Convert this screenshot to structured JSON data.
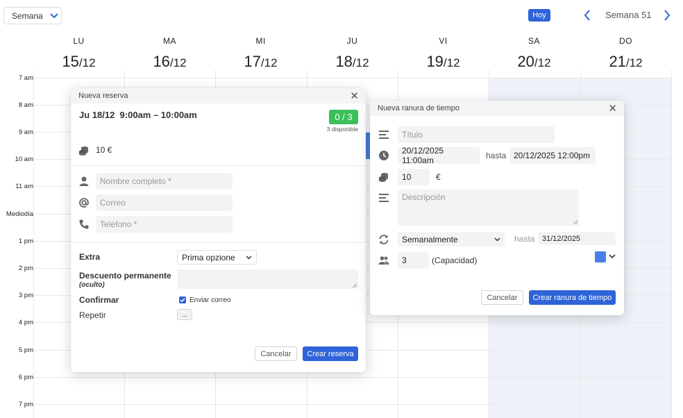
{
  "toolbar": {
    "view_select": "Semana",
    "today_button": "Hoy",
    "week_label": "Semana 51"
  },
  "days": [
    {
      "abbr": "LU",
      "day": "15",
      "month": "/12"
    },
    {
      "abbr": "MA",
      "day": "16",
      "month": "/12"
    },
    {
      "abbr": "MI",
      "day": "17",
      "month": "/12"
    },
    {
      "abbr": "JU",
      "day": "18",
      "month": "/12"
    },
    {
      "abbr": "VI",
      "day": "19",
      "month": "/12"
    },
    {
      "abbr": "SA",
      "day": "20",
      "month": "/12"
    },
    {
      "abbr": "DO",
      "day": "21",
      "month": "/12"
    }
  ],
  "hours": [
    "7 am",
    "8 am",
    "9 am",
    "10 am",
    "11 am",
    "Mediodía",
    "1 pm",
    "2 pm",
    "3 pm",
    "4 pm",
    "5 pm",
    "6 pm",
    "7 pm"
  ],
  "booking": {
    "title": "Nueva reserva",
    "slot": "Ju 18/12  9:00am – 10:00am",
    "capacity_badge": "0 / 3",
    "available": "3 disponible",
    "price": "10 €",
    "name_placeholder": "Nombre completo *",
    "email_placeholder": "Correo",
    "phone_placeholder": "Teléfono *",
    "extra_label": "Extra",
    "extra_value": "Prima opzione",
    "discount_label": "Descuento permanente",
    "discount_sub": "(oculto)",
    "confirm_label": "Confirmar",
    "send_email_label": "Enviar correo",
    "repeat_label": "Repetir",
    "repeat_button": "...",
    "cancel": "Cancelar",
    "submit": "Crear reserva"
  },
  "slot_dialog": {
    "title": "Nueva ranura de tiempo",
    "title_placeholder": "Título",
    "start": "20/12/2025 11:00am",
    "until_label": "hasta",
    "end": "20/12/2025 12:00pm",
    "price": "10",
    "currency": "€",
    "description_placeholder": "Descripción",
    "repeat_value": "Semanalmente",
    "repeat_until_label": "hasta",
    "repeat_until": "31/12/2025",
    "capacity": "3",
    "capacity_label": "(Capacidad)",
    "color": "#4a80e6",
    "cancel": "Cancelar",
    "submit": "Crear ranura de tiempo"
  },
  "colors": {
    "accent": "#2f64d8",
    "success": "#3cbf5a",
    "weekend": "#eef2f8"
  }
}
